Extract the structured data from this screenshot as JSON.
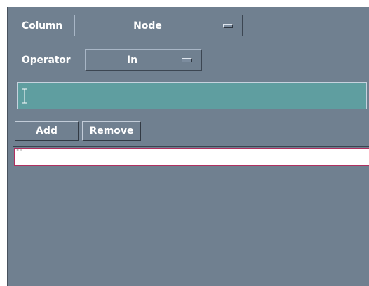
{
  "column": {
    "label": "Column",
    "selected": "Node"
  },
  "operator": {
    "label": "Operator",
    "selected": "In"
  },
  "value_entry": {
    "value": ""
  },
  "buttons": {
    "add_label": "Add",
    "remove_label": "Remove"
  },
  "value_list": {
    "items": [
      "\"\""
    ]
  },
  "colors": {
    "panel_bg": "#708090",
    "entry_bg": "#5f9ea0",
    "list_item_bg": "#ffffff",
    "selection_border": "#b03060"
  },
  "icons": {
    "option_indicator": "option-menu-indicator-icon",
    "text_cursor": "i-beam-cursor-icon"
  }
}
